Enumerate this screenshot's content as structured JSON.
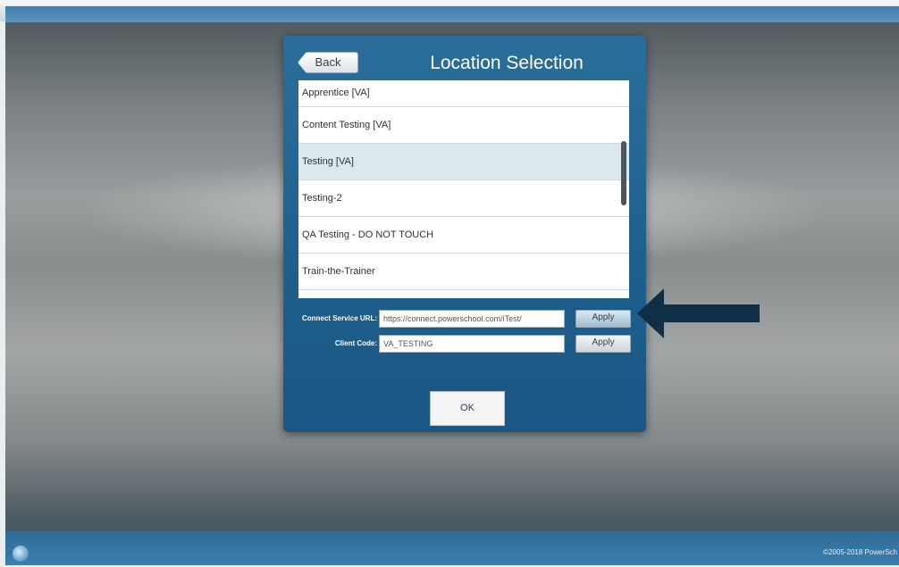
{
  "dialog": {
    "back_label": "Back",
    "title": "Location Selection"
  },
  "locations": [
    {
      "label": "Apprentice [VA]",
      "selected": false
    },
    {
      "label": "Content Testing [VA]",
      "selected": false
    },
    {
      "label": "Testing [VA]",
      "selected": true
    },
    {
      "label": "Testing-2",
      "selected": false
    },
    {
      "label": "QA Testing - DO NOT TOUCH",
      "selected": false
    },
    {
      "label": "Train-the-Trainer",
      "selected": false
    }
  ],
  "connect": {
    "label": "Connect Service URL:",
    "value": "https://connect.powerschool.com/iTest/",
    "apply_label": "Apply"
  },
  "client": {
    "label": "Client Code:",
    "value": "VA_TESTING",
    "apply_label": "Apply"
  },
  "ok_label": "OK",
  "footer": {
    "copyright": "©2005-2018 PowerSch"
  },
  "colors": {
    "dialog_bg": "#1f5f8c",
    "selected_row": "#dbe9ee",
    "arrow": "#0f2f45"
  },
  "icons": {
    "taskbar_logo": "powerschool-logo-icon",
    "pointer": "arrow-left-icon"
  }
}
